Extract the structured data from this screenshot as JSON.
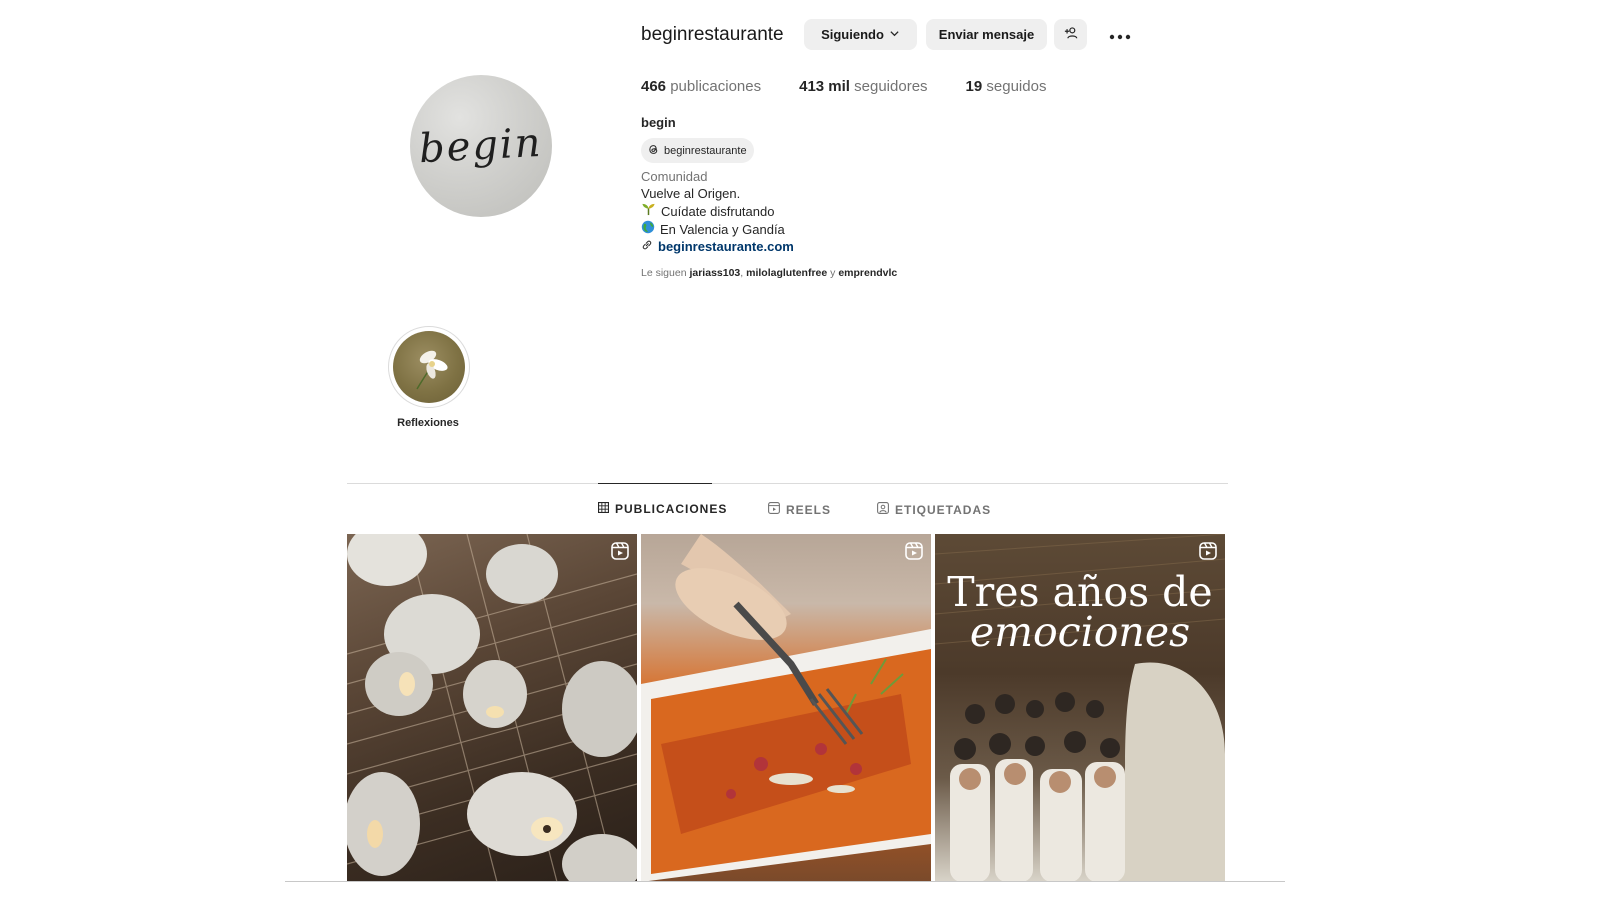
{
  "profile": {
    "username": "beginrestaurante",
    "avatar_text": "begin",
    "buttons": {
      "following": "Siguiendo",
      "message": "Enviar mensaje",
      "suggest_icon": "person-add-icon",
      "more_icon": "more-horizontal-icon"
    },
    "stats": [
      {
        "value": "466",
        "label": "publicaciones"
      },
      {
        "value": "413 mil",
        "label": "seguidores"
      },
      {
        "value": "19",
        "label": "seguidos"
      }
    ],
    "full_name": "begin",
    "threads_handle": "beginrestaurante",
    "bio": {
      "category": "Comunidad",
      "line1": "Vuelve al Origen.",
      "line2": "Cuídate disfrutando",
      "line3": "En Valencia y Gandía",
      "link": "beginrestaurante.com"
    },
    "followed_by": {
      "prefix": "Le siguen",
      "users": [
        "jariass103",
        "milolaglutenfree",
        "emprendvlc"
      ],
      "separator": ",",
      "conjunction": "y"
    }
  },
  "highlights": [
    {
      "label": "Reflexiones"
    }
  ],
  "tabs": [
    {
      "label": "PUBLICACIONES",
      "icon": "grid-icon",
      "active": true
    },
    {
      "label": "REELS",
      "icon": "reels-icon",
      "active": false
    },
    {
      "label": "ETIQUETADAS",
      "icon": "tagged-icon",
      "active": false
    }
  ],
  "posts": [
    {
      "type": "reel",
      "overlay": ""
    },
    {
      "type": "reel",
      "overlay": ""
    },
    {
      "type": "reel",
      "overlay_line1": "Tres años de",
      "overlay_line2": "emociones"
    }
  ]
}
